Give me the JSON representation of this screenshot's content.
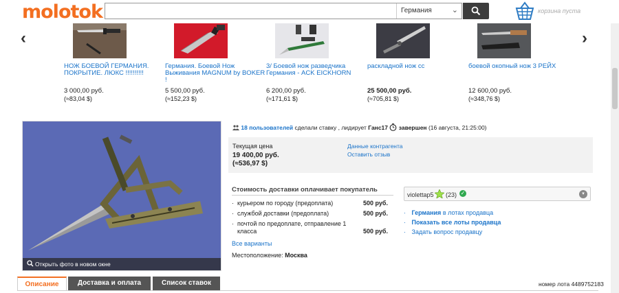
{
  "header": {
    "logo": "molotok",
    "search_placeholder": "",
    "region": "Германия",
    "cart_text": "корзина пуста"
  },
  "carousel": {
    "items": [
      {
        "title": "НОЖ БОЕВОЙ ГЕРМАНИЯ. ПОКРЫТИЕ. ЛЮКС !!!!!!!!!!",
        "price": "3 000,00 руб.",
        "conv": "(≈83,04 $)"
      },
      {
        "title": "Германия. Боевой Нож Выживания MAGNUM by BOKER !",
        "price": "5 500,00 руб.",
        "conv": "(≈152,23 $)"
      },
      {
        "title": "3/ Боевой нож разведчика Германия - ACK EICKHORN",
        "price": "6 200,00 руб.",
        "conv": "(≈171,61 $)"
      },
      {
        "title": "раскладной нож сс",
        "price": "25 500,00 руб.",
        "conv": "(≈705,81 $)"
      },
      {
        "title": "боевой окопный нож 3 РЕЙХ",
        "price": "12 600,00 руб.",
        "conv": "(≈348,76 $)"
      }
    ]
  },
  "photo": {
    "open_text": "Открыть фото в новом окне"
  },
  "bids": {
    "users_link": "18 пользователей",
    "made_bids": "сделали ставку , лидирует",
    "leader": "Ганс17",
    "status": "завершен",
    "date": "(16 августа, 21:25:00)"
  },
  "price": {
    "label": "Текущая цена",
    "value": "19 400,00 руб.",
    "conv": "(≈536,97 $)",
    "link_contractor": "Данные контрагента",
    "link_review": "Оставить отзыв"
  },
  "delivery": {
    "title": "Стоимость доставки оплачивает покупатель",
    "rows": [
      {
        "name": "курьером по городу (предоплата)",
        "val": "500 руб."
      },
      {
        "name": "службой доставки (предоплата)",
        "val": "500 руб."
      },
      {
        "name": "почтой по предоплате, отправление 1 класса",
        "val": "500 руб."
      }
    ],
    "all_variants": "Все варианты",
    "location_label": "Местоположение:",
    "location_value": "Москва"
  },
  "seller": {
    "name": "violettap5",
    "count": "(23)",
    "link1_a": "Германия",
    "link1_b": "в лотах продавца",
    "link2": "Показать все лоты продавца",
    "link3": "Задать вопрос продавцу"
  },
  "tabs": {
    "t1": "Описание",
    "t2": "Доставка и оплата",
    "t3": "Список ставок",
    "lot_number": "номер лота 4489752183"
  },
  "colors": {
    "brand": "#f36f21",
    "link": "#1a73c9"
  }
}
